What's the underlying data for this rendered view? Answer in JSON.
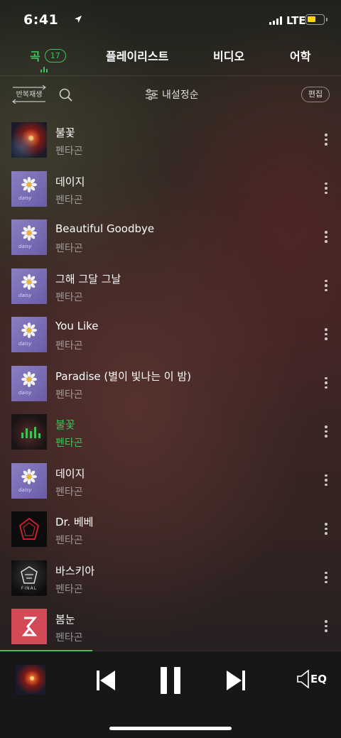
{
  "status_bar": {
    "time": "6:41",
    "network": "LTE",
    "battery_level": 0.4,
    "icons": [
      "location-arrow-icon",
      "signal-icon",
      "battery-icon"
    ]
  },
  "tabs": [
    {
      "label": "곡",
      "count": "17",
      "active": true
    },
    {
      "label": "플레이리스트",
      "active": false
    },
    {
      "label": "비디오",
      "active": false
    },
    {
      "label": "어학",
      "active": false
    }
  ],
  "toolbar": {
    "repeat_label": "반복재생",
    "sort_label": "내설정순",
    "edit_label": "편집"
  },
  "songs": [
    {
      "title": "불꽃",
      "artist": "펜타곤",
      "art": "fire"
    },
    {
      "title": "데이지",
      "artist": "펜타곤",
      "art": "daisy"
    },
    {
      "title": "Beautiful Goodbye",
      "artist": "펜타곤",
      "art": "daisy"
    },
    {
      "title": "그해 그달 그날",
      "artist": "펜타곤",
      "art": "daisy"
    },
    {
      "title": "You Like",
      "artist": "펜타곤",
      "art": "daisy"
    },
    {
      "title": "Paradise (별이 빛나는 이 밤)",
      "artist": "펜타곤",
      "art": "daisy"
    },
    {
      "title": "불꽃",
      "artist": "펜타곤",
      "art": "fire-playing",
      "playing": true
    },
    {
      "title": "데이지",
      "artist": "펜타곤",
      "art": "daisy"
    },
    {
      "title": "Dr. 베베",
      "artist": "펜타곤",
      "art": "drbebe"
    },
    {
      "title": "바스키아",
      "artist": "펜타곤",
      "art": "final"
    },
    {
      "title": "봄눈",
      "artist": "펜타곤",
      "art": "pentagon"
    }
  ],
  "album_art_text": {
    "final": "FINAL"
  },
  "player": {
    "progress": 0.27,
    "eq_label": "EQ"
  },
  "colors": {
    "accent": "#3ec15a",
    "player_bg": "#171717"
  }
}
